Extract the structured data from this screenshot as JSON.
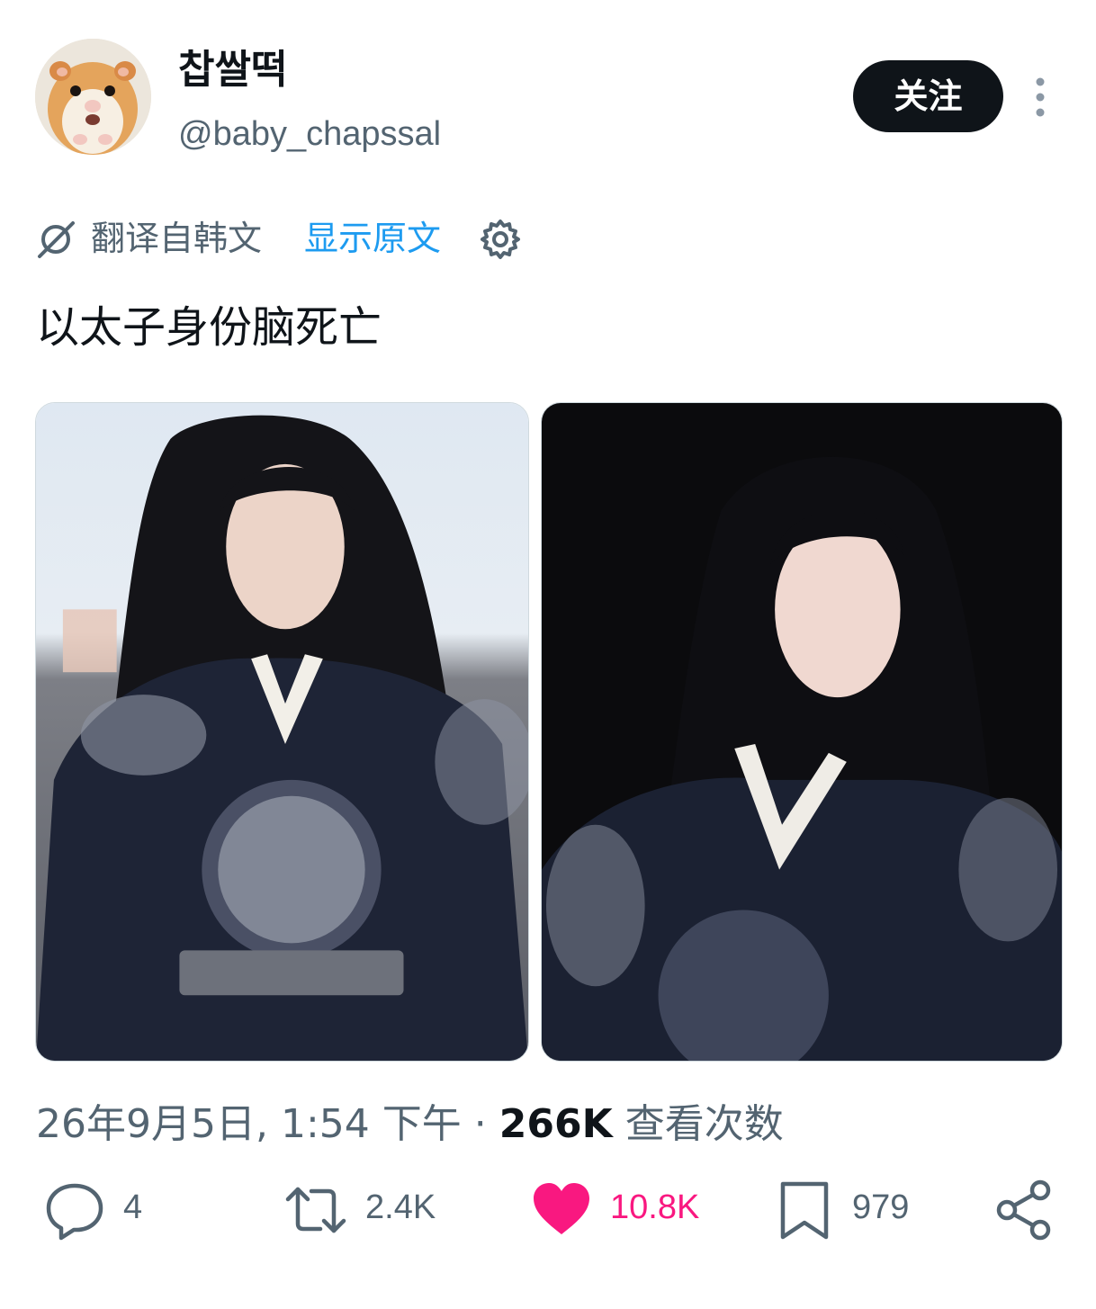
{
  "author": {
    "display_name": "찹쌀떡",
    "handle": "@baby_chapssal"
  },
  "header": {
    "follow_label": "关注"
  },
  "translation": {
    "notice": "翻译自韩文",
    "show_original": "显示原文"
  },
  "post": {
    "text": "以太子身份脑死亡",
    "timestamp": "26年9月5日, 1:54 下午",
    "separator": "·",
    "views": "266K",
    "views_label": "查看次数"
  },
  "actions": {
    "replies": "4",
    "reposts": "2.4K",
    "likes": "10.8K",
    "bookmarks": "979"
  },
  "colors": {
    "text_primary": "#0f1419",
    "text_secondary": "#536471",
    "link": "#1d9bf0",
    "like_active": "#f91880",
    "follow_button_bg": "#0f1419"
  },
  "icons": {
    "more": "more-vertical-icon",
    "translate": "translate-off-icon",
    "settings": "gear-icon",
    "reply": "reply-icon",
    "repost": "repost-icon",
    "like": "heart-filled-icon",
    "bookmark": "bookmark-icon",
    "share": "share-icon"
  }
}
